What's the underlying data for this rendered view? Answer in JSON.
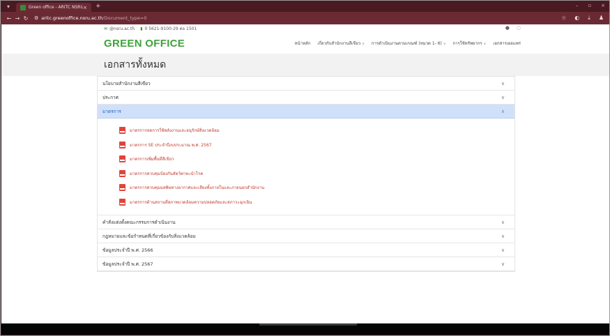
{
  "browser": {
    "tab_title": "Green office - ARITC NSRU",
    "url_host": "aritc.greenoffice.nsru.ac.th",
    "url_path": "/Document_type=0"
  },
  "topinfo": {
    "email": "@nsru.ac.th",
    "phone": "0 5621-9100-29 ต่อ 1501"
  },
  "header": {
    "logo": "GREEN OFFICE",
    "menu": [
      {
        "label": "หน้าหลัก",
        "dropdown": false
      },
      {
        "label": "เกี่ยวกับสำนักงานสีเขียว",
        "dropdown": true
      },
      {
        "label": "การดำเนินงานตามเกณฑ์ (หมวด 1- 6)",
        "dropdown": true
      },
      {
        "label": "การใช้ทรัพยากร",
        "dropdown": true
      },
      {
        "label": "เอกสารเผยแพร่",
        "dropdown": false
      }
    ]
  },
  "page_title": "เอกสารทั้งหมด",
  "accordion": {
    "items_before": [
      "นโยบายสำนักงานสีเขียว",
      "ประกาศ"
    ],
    "active": "มาตรการ",
    "documents": [
      "มาตรการลดการใช้พลังงานและอนุรักษ์สิ่งแวดล้อม",
      "มาตรการ SE ประจำปีงบประมาณ พ.ศ. 2567",
      "มาตรการเพิ่มพื้นที่สีเขียว",
      "มาตรการควบคุมป้องกันสัตว์พาหะนำโรค",
      "มาตรการควบคุมมลพิษทางอากาศและเสียงทั้งภายในและภายนอกสำนักงาน",
      "มาตรการด้านสถานที่สภาพแวดล้อมความปลอดภัยและสภาวะฉุกเฉิน"
    ],
    "items_after": [
      "คำสั่งแต่งตั้งคณะกรรมการดำเนินงาน",
      "กฎหมายและข้อกำหนดที่เกี่ยวข้องกับสิ่งแวดล้อม",
      "ข้อมูลประจำปี พ.ศ. 2566",
      "ข้อมูลประจำปี พ.ศ. 2567"
    ]
  },
  "colors": {
    "brand_green": "#3fa33b",
    "active_bg": "#cfe0fb",
    "link_red": "#c0392b"
  }
}
